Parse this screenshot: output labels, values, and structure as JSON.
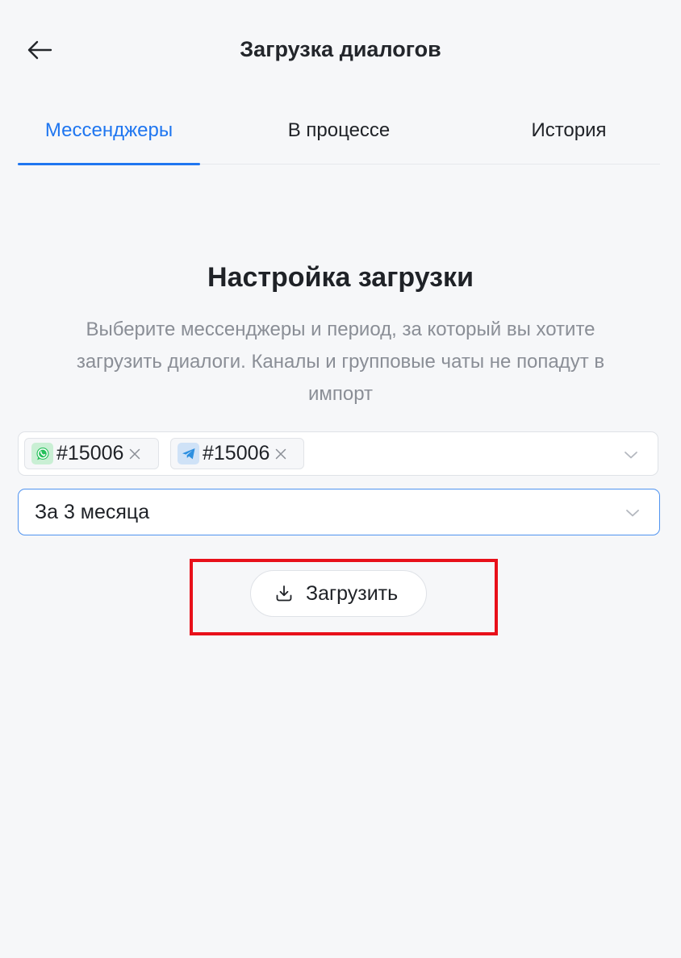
{
  "header": {
    "title": "Загрузка диалогов",
    "back_icon": "arrow-left-icon"
  },
  "tabs": [
    {
      "label": "Мессенджеры",
      "active": true
    },
    {
      "label": "В процессе",
      "active": false
    },
    {
      "label": "История",
      "active": false
    }
  ],
  "section": {
    "title": "Настройка загрузки",
    "description": "Выберите мессенджеры и период, за который вы хотите загрузить диалоги. Каналы и групповые чаты не попадут в импорт"
  },
  "messenger_select": {
    "tags": [
      {
        "icon": "whatsapp-icon",
        "label": "#15006",
        "color": "#25c05a"
      },
      {
        "icon": "telegram-icon",
        "label": "#15006",
        "color": "#2c8fe0"
      }
    ],
    "chevron_icon": "chevron-down-icon"
  },
  "period_select": {
    "value": "За 3 месяца",
    "chevron_icon": "chevron-down-icon"
  },
  "download_button": {
    "label": "Загрузить",
    "icon": "download-icon"
  },
  "colors": {
    "accent": "#1f76f0",
    "highlight": "#e8101a",
    "background": "#f6f7f9"
  }
}
